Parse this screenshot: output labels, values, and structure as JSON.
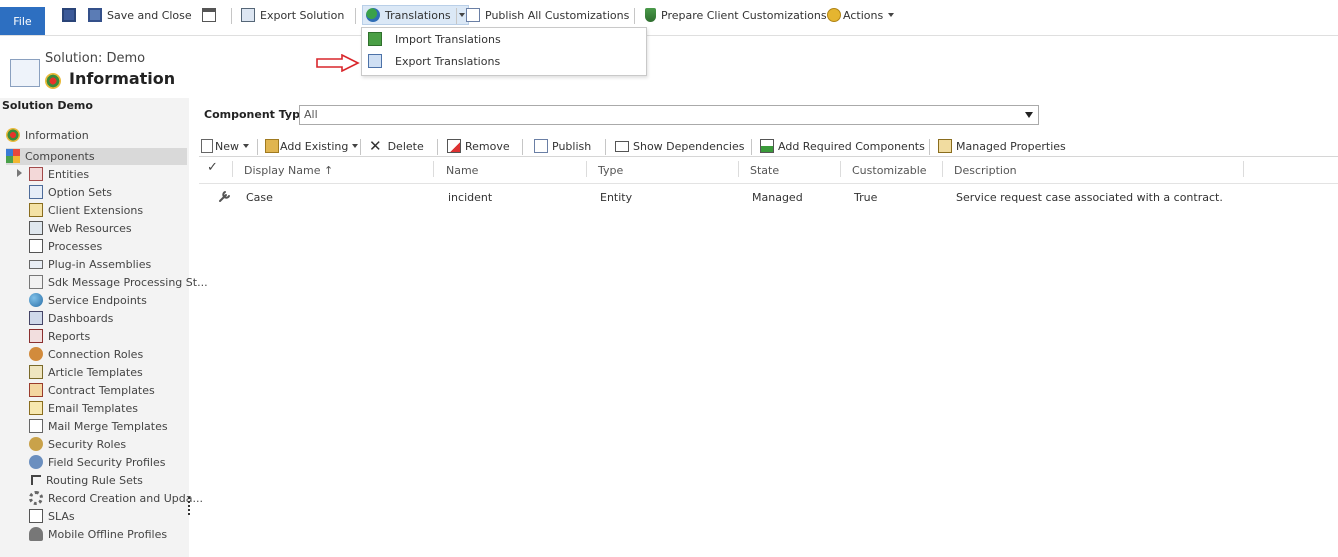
{
  "ribbon": {
    "file_label": "File",
    "save_close_label": "Save and Close",
    "export_solution_label": "Export Solution",
    "translations_label": "Translations",
    "publish_all_label": "Publish All Customizations",
    "prepare_client_label": "Prepare Client Customizations",
    "actions_label": "Actions"
  },
  "translations_menu": {
    "items": [
      {
        "label": "Import Translations"
      },
      {
        "label": "Export Translations"
      }
    ]
  },
  "header": {
    "solution_label": "Solution: Demo",
    "page_title": "Information"
  },
  "nav": {
    "heading": "Solution Demo",
    "items": [
      {
        "label": "Information"
      },
      {
        "label": "Components"
      },
      {
        "label": "Entities"
      },
      {
        "label": "Option Sets"
      },
      {
        "label": "Client Extensions"
      },
      {
        "label": "Web Resources"
      },
      {
        "label": "Processes"
      },
      {
        "label": "Plug-in Assemblies"
      },
      {
        "label": "Sdk Message Processing St..."
      },
      {
        "label": "Service Endpoints"
      },
      {
        "label": "Dashboards"
      },
      {
        "label": "Reports"
      },
      {
        "label": "Connection Roles"
      },
      {
        "label": "Article Templates"
      },
      {
        "label": "Contract Templates"
      },
      {
        "label": "Email Templates"
      },
      {
        "label": "Mail Merge Templates"
      },
      {
        "label": "Security Roles"
      },
      {
        "label": "Field Security Profiles"
      },
      {
        "label": "Routing Rule Sets"
      },
      {
        "label": "Record Creation and Upda..."
      },
      {
        "label": "SLAs"
      },
      {
        "label": "Mobile Offline Profiles"
      }
    ]
  },
  "filter": {
    "label": "Component Type",
    "value": "All"
  },
  "toolbar": {
    "new_label": "New",
    "add_existing_label": "Add Existing",
    "delete_label": "Delete",
    "remove_label": "Remove",
    "publish_label": "Publish",
    "show_dependencies_label": "Show Dependencies",
    "add_required_label": "Add Required Components",
    "managed_properties_label": "Managed Properties"
  },
  "grid": {
    "columns": [
      "Display Name ↑",
      "Name",
      "Type",
      "State",
      "Customizable",
      "Description"
    ],
    "rows": [
      {
        "display_name": "Case",
        "name": "incident",
        "type": "Entity",
        "state": "Managed",
        "customizable": "True",
        "description": "Service request case associated with a contract."
      }
    ]
  },
  "colors": {
    "file_button": "#2d6fc1",
    "annotation_arrow": "#d9262b",
    "nav_selected": "#d9d9d9"
  }
}
